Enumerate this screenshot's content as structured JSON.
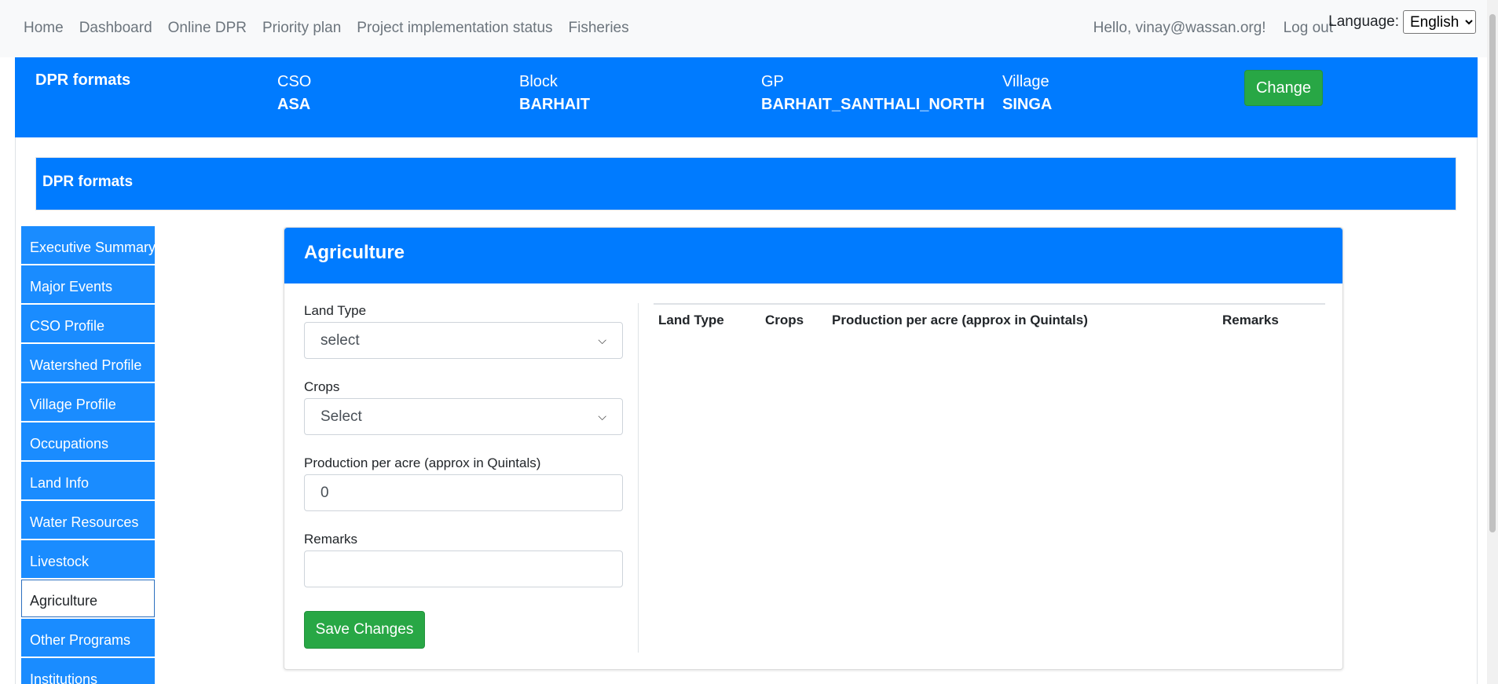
{
  "nav": {
    "links": [
      "Home",
      "Dashboard",
      "Online DPR",
      "Priority plan",
      "Project implementation status",
      "Fisheries"
    ],
    "greeting": "Hello, vinay@wassan.org!",
    "logout": "Log out",
    "language_label": "Language:",
    "language_value": "English"
  },
  "context": {
    "title": "DPR formats",
    "fields": [
      {
        "label": "CSO",
        "value": "ASA"
      },
      {
        "label": "Block",
        "value": "BARHAIT"
      },
      {
        "label": "GP",
        "value": "BARHAIT_SANTHALI_NORTH"
      },
      {
        "label": "Village",
        "value": "SINGA"
      }
    ],
    "change_label": "Change"
  },
  "section_banner": "DPR formats",
  "sidebar": {
    "items": [
      "Executive Summary",
      "Major Events",
      "CSO Profile",
      "Watershed Profile",
      "Village Profile",
      "Occupations",
      "Land Info",
      "Water Resources",
      "Livestock",
      "Agriculture",
      "Other Programs",
      "Institutions"
    ],
    "active": "Agriculture"
  },
  "card": {
    "title": "Agriculture",
    "form": {
      "land_type_label": "Land Type",
      "land_type_value": "select",
      "crops_label": "Crops",
      "crops_value": "Select",
      "production_label": "Production per acre (approx in Quintals)",
      "production_value": "0",
      "remarks_label": "Remarks",
      "remarks_value": "",
      "save_label": "Save Changes"
    },
    "table": {
      "headers": [
        "Land Type",
        "Crops",
        "Production per acre (approx in Quintals)",
        "Remarks"
      ]
    }
  },
  "colors": {
    "primary": "#007bff",
    "success": "#28a745",
    "navbar_bg": "#f8f9fa"
  }
}
